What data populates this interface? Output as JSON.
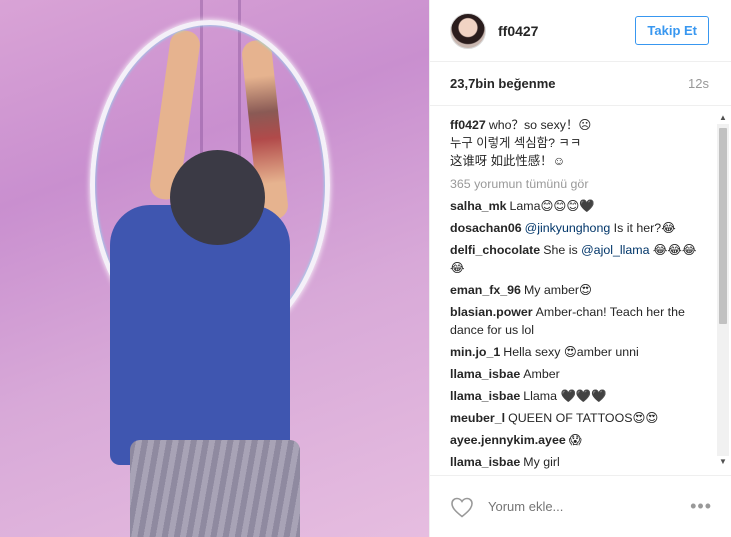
{
  "post": {
    "username": "ff0427",
    "follow_label": "Takip Et",
    "likes": "23,7bin beğenme",
    "time": "12s",
    "caption": {
      "user": "ff0427",
      "line1": "who？so sexy！☹",
      "line2": "누구 이렇게 섹심함? ㅋㅋ",
      "line3": "这谁呀 如此性感！☺"
    },
    "view_all": "365 yorumun tümünü gör",
    "comments": [
      {
        "user": "salha_mk",
        "text": "Lama😊😊😊🖤"
      },
      {
        "user": "dosachan06",
        "mention": "@jinkyunghong",
        "text": " Is it her?😂"
      },
      {
        "user": "delfi_chocolate",
        "prefix": "She is ",
        "mention": "@ajol_llama",
        "text": " 😂😂😂😂"
      },
      {
        "user": "eman_fx_96",
        "text": "My amber😍"
      },
      {
        "user": "blasian.power",
        "text": "Amber-chan! Teach her the dance for us lol"
      },
      {
        "user": "min.jo_1",
        "text": "Hella sexy 😍amber unni"
      },
      {
        "user": "llama_isbae",
        "text": "Amber"
      },
      {
        "user": "llama_isbae",
        "text": "Llama 🖤🖤🖤"
      },
      {
        "user": "meuber_l",
        "text": "QUEEN OF TATTOOS😍😍"
      },
      {
        "user": "ayee.jennykim.ayee",
        "text": "😱"
      },
      {
        "user": "llama_isbae",
        "text": "My girl"
      }
    ],
    "comment_placeholder": "Yorum ekle...",
    "more_label": "•••"
  }
}
